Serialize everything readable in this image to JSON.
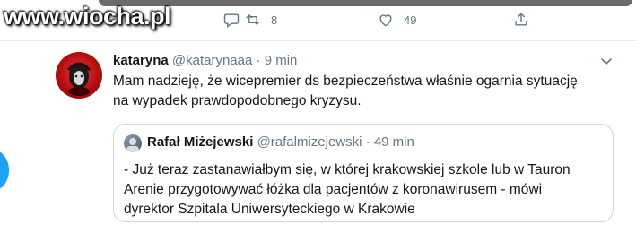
{
  "watermark": "www.wiocha.pl",
  "previous_tweet": {
    "retweet_count": "8",
    "like_count": "49"
  },
  "tweet": {
    "display_name": "kataryna",
    "handle": "@katarynaaa",
    "dot": "·",
    "time": "9 min",
    "text_line1": "Mam nadzieję, że wicepremier ds bezpieczeństwa właśnie ogarnia sytuację",
    "text_line2": "na wypadek prawdopodobnego kryzysu."
  },
  "quoted_tweet": {
    "display_name": "Rafał Miżejewski",
    "handle": "@rafalmizejewski",
    "dot": "·",
    "time": "49 min",
    "text_line1": "- Już teraz zastanawiałbym się, w której krakowskiej szkole lub w Tauron",
    "text_line2": "Arenie przygotowywać łóżka dla pacjentów z koronawirusem - mówi",
    "text_line3": "dyrektor Szpitala Uniwersyteckiego w Krakowie"
  },
  "colors": {
    "accent": "#1da1f2",
    "secondary_text": "#657786",
    "border": "#e6ecf0"
  },
  "icons": [
    "comment-icon",
    "retweet-icon",
    "like-icon",
    "share-icon",
    "chevron-down-icon"
  ]
}
